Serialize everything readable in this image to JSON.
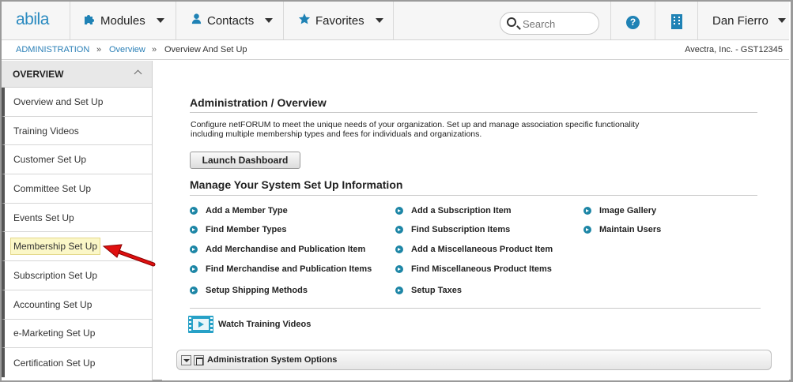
{
  "app": {
    "logo": "abila"
  },
  "topnav": {
    "modules_label": "Modules",
    "contacts_label": "Contacts",
    "favorites_label": "Favorites",
    "search_placeholder": "Search",
    "help_glyph": "?",
    "user_name": "Dan Fierro",
    "accent": "#1f82b5"
  },
  "breadcrumb": {
    "items": [
      "ADMINISTRATION",
      "Overview",
      "Overview And Set Up"
    ],
    "separator": "»",
    "org": "Avectra, Inc. - GST12345"
  },
  "sidebar": {
    "title": "OVERVIEW",
    "items": [
      "Overview and Set Up",
      "Training Videos",
      "Customer Set Up",
      "Committee Set Up",
      "Events Set Up",
      "Membership Set Up",
      "Subscription Set Up",
      "Accounting Set Up",
      "e-Marketing Set Up",
      "Certification Set Up"
    ],
    "highlighted_item": "Membership Set Up"
  },
  "main": {
    "title": "Administration / Overview",
    "description": "Configure netFORUM to meet the unique needs of your organization. Set up and manage association specific functionality including multiple membership types and fees for individuals and organizations.",
    "launch_button": "Launch Dashboard",
    "setup_heading": "Manage Your System Set Up Information",
    "setup_links": {
      "col1": [
        "Add a Member Type",
        "Find Member Types",
        "Add Merchandise and Publication Item",
        "Find Merchandise and Publication Items",
        "Setup Shipping Methods"
      ],
      "col2": [
        "Add a Subscription Item",
        "Find Subscription Items",
        "Add a Miscellaneous Product Item",
        "Find Miscellaneous Product Items",
        "Setup Taxes"
      ],
      "col3": [
        "Image Gallery",
        "Maintain Users"
      ]
    },
    "video_link": "Watch Training Videos",
    "panel_title": "Administration System Options"
  },
  "icons": [
    "puzzle-icon",
    "person-icon",
    "star-icon",
    "search-icon",
    "help-icon",
    "building-icon",
    "chevron-up-icon",
    "arrow-icon",
    "film-icon",
    "bullet-arrow-icon"
  ],
  "colors": {
    "link": "#2a7fb6",
    "bullet": "#1d86a6",
    "highlight": "#fbf7c7",
    "annotation_arrow": "#e01010"
  }
}
